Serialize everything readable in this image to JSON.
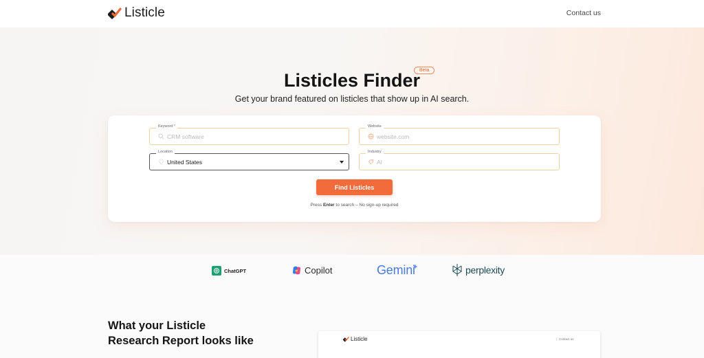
{
  "header": {
    "brand_name": "Listicle",
    "contact_label": "Contact us"
  },
  "hero": {
    "title": "Listicles Finder",
    "badge": "Beta",
    "subtitle": "Get your brand featured on listicles that show up in AI search."
  },
  "form": {
    "keyword": {
      "label": "Keyword",
      "required_mark": "*",
      "placeholder": "CRM software",
      "value": ""
    },
    "website": {
      "label": "Website",
      "placeholder": "website.com",
      "value": ""
    },
    "location": {
      "label": "Location",
      "value": "United States"
    },
    "industry": {
      "label": "Industry",
      "placeholder": "AI",
      "value": ""
    },
    "submit_label": "Find Listicles",
    "hint_prefix": "Press",
    "hint_key": "Enter",
    "hint_suffix": "to search – No sign-up required"
  },
  "ai_logos": [
    {
      "name": "ChatGPT",
      "icon": "chatgpt-icon",
      "color": "#1f9f74"
    },
    {
      "name": "Copilot",
      "icon": "copilot-icon"
    },
    {
      "name": "Gemini",
      "icon": "gemini-sparkle-icon",
      "color": "#4a7bd8"
    },
    {
      "name": "perplexity",
      "icon": "perplexity-icon",
      "color": "#1d4a52"
    }
  ],
  "report_section": {
    "title": "What your Listicle Research Report looks like",
    "preview": {
      "brand_name": "Listicle",
      "contact_label": "Contact us"
    }
  },
  "colors": {
    "accent": "#f26b3a",
    "field_border": "#ecd3a5"
  }
}
